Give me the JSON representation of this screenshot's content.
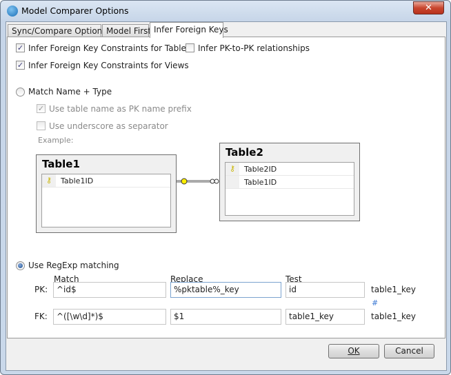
{
  "window": {
    "title": "Model Comparer Options",
    "close": "✕"
  },
  "tabs": [
    {
      "label": "Sync/Compare Options"
    },
    {
      "label": "Model First"
    },
    {
      "label": "Infer Foreign Keys"
    }
  ],
  "options": {
    "infer_tables": {
      "label": "Infer Foreign Key Constraints for Tables",
      "checked": true
    },
    "infer_pk_pk": {
      "label": "Infer PK-to-PK relationships",
      "checked": false
    },
    "infer_views": {
      "label": "Infer Foreign Key Constraints for Views",
      "checked": true
    }
  },
  "match_name_type": {
    "label": "Match Name + Type",
    "selected": false,
    "use_table_name": {
      "label": "Use table name as PK name prefix",
      "checked": true
    },
    "use_underscore": {
      "label": "Use underscore  as separator",
      "checked": false
    },
    "example_label": "Example:"
  },
  "diagram": {
    "table1": {
      "name": "Table1",
      "columns": [
        "Table1ID"
      ]
    },
    "table2": {
      "name": "Table2",
      "columns": [
        "Table2ID",
        "Table1ID"
      ]
    }
  },
  "regexp": {
    "label": "Use RegExp matching",
    "selected": true,
    "headers": {
      "match": "Match",
      "replace": "Replace",
      "test": "Test"
    },
    "pk": {
      "label": "PK:",
      "match": "^id$",
      "replace": "%pktable%_key",
      "test": "id",
      "result": "table1_key"
    },
    "equal_sign": "#",
    "fk": {
      "label": "FK:",
      "match": "^([\\w\\d]*)$",
      "replace": "$1",
      "test": "table1_key",
      "result": "table1_key"
    }
  },
  "buttons": {
    "ok": "OK",
    "cancel": "Cancel"
  }
}
